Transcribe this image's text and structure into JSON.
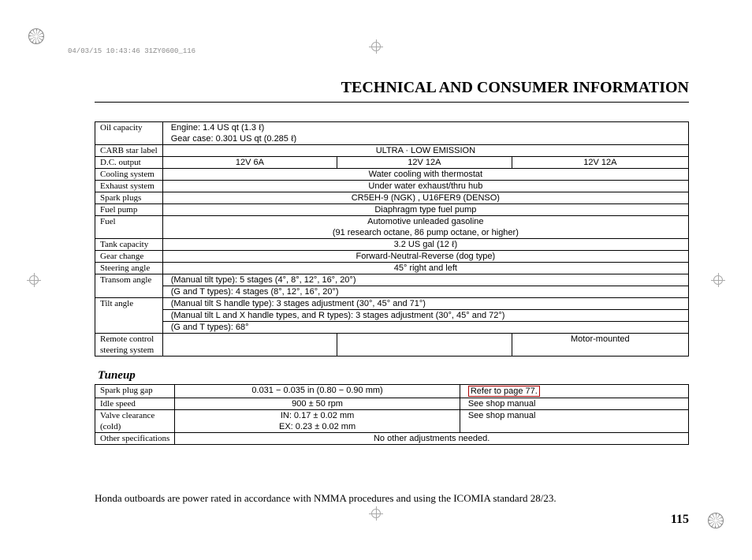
{
  "stamp": "04/03/15 10:43:46 31ZY0600_116",
  "title": "TECHNICAL AND CONSUMER INFORMATION",
  "specs": {
    "oil_capacity": {
      "label": "Oil capacity",
      "line1": "Engine:  1.4 US qt (1.3 ℓ)",
      "line2": "Gear case:   0.301 US qt (0.285 ℓ)"
    },
    "carb": {
      "label": "CARB star label",
      "value": "ULTRA · LOW EMISSION"
    },
    "dc_output": {
      "label": "D.C. output",
      "col1": "12V   6A",
      "col2": "12V   12A",
      "col3": "12V   12A"
    },
    "cooling": {
      "label": "Cooling system",
      "value": "Water cooling with thermostat"
    },
    "exhaust": {
      "label": "Exhaust system",
      "value": "Under water exhaust/thru hub"
    },
    "spark_plugs": {
      "label": "Spark plugs",
      "value": "CR5EH-9 (NGK) ,  U16FER9 (DENSO)"
    },
    "fuel_pump": {
      "label": "Fuel pump",
      "value": "Diaphragm type fuel pump"
    },
    "fuel": {
      "label": "Fuel",
      "line1": "Automotive unleaded gasoline",
      "line2": "(91 research octane, 86 pump octane, or higher)"
    },
    "tank": {
      "label": "Tank capacity",
      "value": "3.2 US gal (12 ℓ)"
    },
    "gear_change": {
      "label": "Gear change",
      "value": "Forward-Neutral-Reverse (dog type)"
    },
    "steering_angle": {
      "label": "Steering angle",
      "value": "45° right and left"
    },
    "transom_angle": {
      "label": "Transom angle",
      "line1": "(Manual tilt type):   5 stages (4°, 8°, 12°, 16°, 20°)",
      "line2": "(G and T types):  4 stages (8°, 12°, 16°, 20°)"
    },
    "tilt_angle": {
      "label": "Tilt angle",
      "line1": "(Manual tilt S handle type):  3 stages adjustment (30°, 45° and 71°)",
      "line2": "(Manual tilt L and X handle types, and R types):    3 stages adjustment (30°, 45° and 72°)",
      "line3": "(G and T types):  68°"
    },
    "remote": {
      "label1": "Remote control",
      "label2": "steering system",
      "col1": "",
      "col2": "",
      "col3": "Motor-mounted"
    }
  },
  "tuneup_title": "Tuneup",
  "tuneup": {
    "spark_gap": {
      "label": "Spark plug gap",
      "value": "0.031 − 0.035 in (0.80 − 0.90 mm)",
      "ref": "Refer to page 77."
    },
    "idle": {
      "label": "Idle speed",
      "value": "900 ± 50 rpm",
      "ref": "See shop manual"
    },
    "valve": {
      "label1": "Valve clearance",
      "label2": "(cold)",
      "line1": "IN: 0.17 ± 0.02 mm",
      "line2": "EX: 0.23 ± 0.02 mm",
      "ref": "See shop manual"
    },
    "other": {
      "label": "Other specifications",
      "value": "No other adjustments needed."
    }
  },
  "footnote": "Honda outboards are power rated in accordance with NMMA procedures and using the ICOMIA standard 28/23.",
  "page_number": "115"
}
